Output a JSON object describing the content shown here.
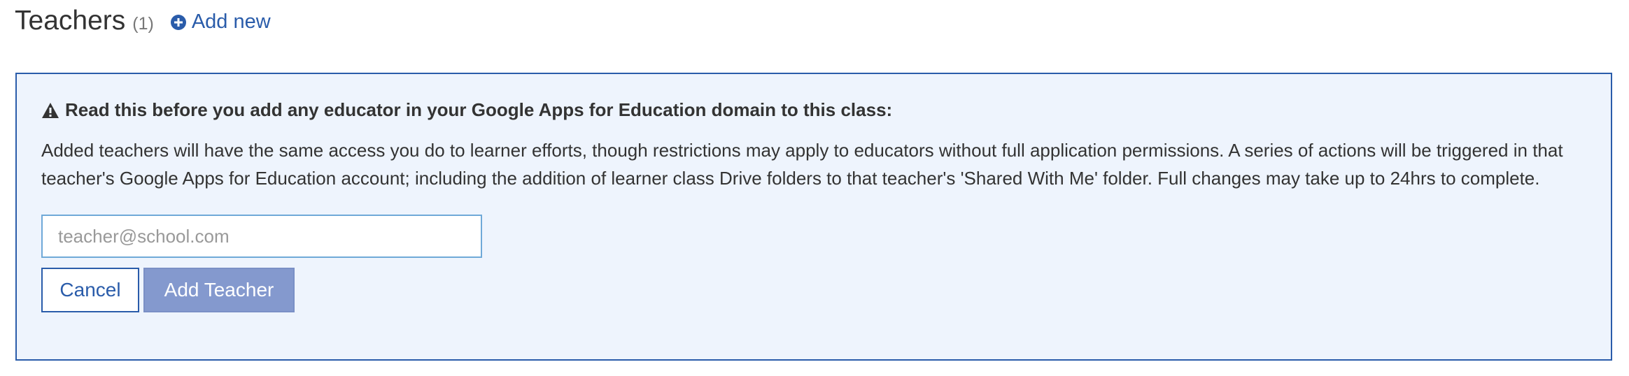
{
  "header": {
    "title": "Teachers",
    "count": "(1)",
    "add_new_label": "Add new"
  },
  "panel": {
    "warning_title": "Read this before you add any educator in your Google Apps for Education domain to this class:",
    "body": "Added teachers will have the same access you do to learner efforts, though restrictions may apply to educators without full application permissions. A series of actions will be triggered in that teacher's Google Apps for Education account; including the addition of learner class Drive folders to that teacher's 'Shared With Me' folder. Full changes may take up to 24hrs to complete.",
    "email_placeholder": "teacher@school.com",
    "email_value": ""
  },
  "actions": {
    "cancel_label": "Cancel",
    "add_label": "Add Teacher"
  },
  "icons": {
    "add_new": "plus-circle-icon",
    "warning": "warning-triangle-icon"
  },
  "colors": {
    "link": "#2a5caa",
    "panel_background": "#eef4fd",
    "panel_border": "#2a5caa",
    "add_button": "#8499ce"
  }
}
